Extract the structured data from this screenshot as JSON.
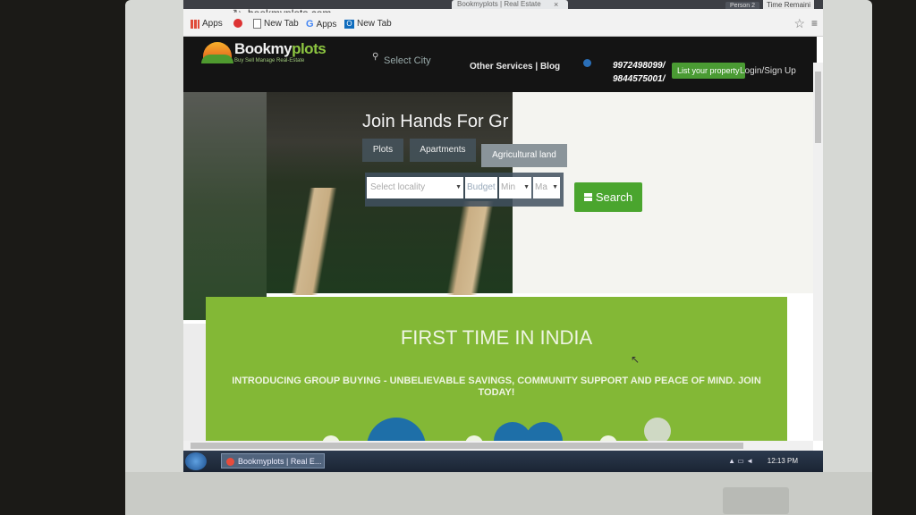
{
  "browser": {
    "tab_title": "Bookmyplots | Real Estate",
    "tab_close": "×",
    "person_label": "Person 2",
    "time_chip": "Time Remaini",
    "url": "bookmyplots.com",
    "bookmarks": [
      "Apps",
      "New Tab",
      "Apps",
      "New Tab"
    ]
  },
  "site": {
    "logo": {
      "main": "Bookmy",
      "accent": "plots",
      "tagline": "Buy  Sell  Manage  Real-Estate"
    },
    "city_select": "Select City",
    "services": "Other Services | Blog",
    "phones": [
      "9972498099/",
      "9844575001/"
    ],
    "list_button": "List your property",
    "login": "Login/Sign Up"
  },
  "hero": {
    "title": "Join Hands For Gr",
    "tabs": [
      "Plots",
      "Apartments",
      "Agricultural land"
    ],
    "locality_placeholder": "Select locality",
    "budget_label": "Budget",
    "min_placeholder": "Min",
    "max_placeholder": "Ma",
    "search_label": "Search"
  },
  "banner": {
    "title": "FIRST TIME IN INDIA",
    "subtitle": "INTRODUCING GROUP BUYING - UNBELIEVABLE SAVINGS, COMMUNITY SUPPORT AND PEACE OF MIND. JOIN TODAY!"
  },
  "taskbar": {
    "window_label": "Bookmyplots | Real E...",
    "clock": "12:13 PM"
  },
  "colors": {
    "brand_green": "#8dc641",
    "banner_green": "#83b836",
    "search_green": "#4aa52e"
  }
}
